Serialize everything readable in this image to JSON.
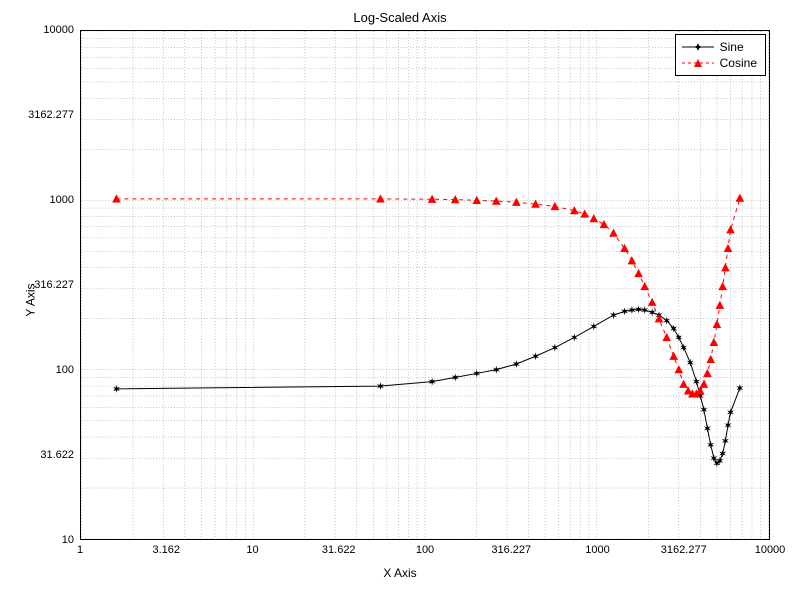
{
  "chart_data": {
    "type": "line",
    "title": "Log-Scaled Axis",
    "xlabel": "X Axis",
    "ylabel": "Y Axis",
    "xscale": "log",
    "yscale": "log",
    "xlim": [
      1,
      10000
    ],
    "ylim": [
      10,
      10000
    ],
    "x_ticks": [
      1,
      3.162,
      10,
      31.622,
      100,
      316.227,
      1000,
      3162.277,
      10000
    ],
    "x_tick_labels": [
      "1",
      "3.162",
      "10",
      "31.622",
      "100",
      "316.227",
      "1000",
      "3162.277",
      "10000"
    ],
    "y_ticks": [
      10,
      31.622,
      100,
      316.227,
      1000,
      3162.277,
      10000
    ],
    "y_tick_labels": [
      "10",
      "31.622",
      "100",
      "316.227",
      "1000",
      "3162.277",
      "10000"
    ],
    "grid": true,
    "minor_grid": true,
    "legend_position": "upper right",
    "series": [
      {
        "name": "Sine",
        "color": "#000000",
        "marker": "star6",
        "linestyle": "solid",
        "x": [
          1.6,
          55,
          110,
          150,
          200,
          260,
          340,
          440,
          570,
          740,
          960,
          1250,
          1450,
          1600,
          1750,
          1900,
          2100,
          2300,
          2550,
          2800,
          3000,
          3200,
          3500,
          3800,
          4000,
          4200,
          4400,
          4600,
          4800,
          5000,
          5200,
          5400,
          5600,
          5800,
          6000,
          6800
        ],
        "y": [
          77,
          80,
          85,
          90,
          95,
          100,
          108,
          120,
          135,
          155,
          180,
          210,
          221,
          225,
          227,
          225,
          218,
          210,
          195,
          175,
          155,
          135,
          110,
          85,
          70,
          58,
          45,
          36,
          30,
          28,
          29,
          32,
          38,
          47,
          56,
          78
        ]
      },
      {
        "name": "Cosine",
        "color": "#ff0000",
        "marker": "triangle",
        "linestyle": "dashed",
        "x": [
          1.6,
          55,
          110,
          150,
          200,
          260,
          340,
          440,
          570,
          740,
          850,
          960,
          1100,
          1250,
          1450,
          1600,
          1750,
          1900,
          2100,
          2300,
          2550,
          2800,
          3000,
          3200,
          3400,
          3600,
          3800,
          4000,
          4200,
          4400,
          4600,
          4800,
          5000,
          5200,
          5400,
          5600,
          5800,
          6000,
          6800
        ],
        "y": [
          1020,
          1020,
          1015,
          1010,
          1000,
          990,
          975,
          950,
          920,
          870,
          830,
          780,
          720,
          640,
          520,
          440,
          370,
          310,
          250,
          200,
          155,
          120,
          100,
          82,
          75,
          72,
          72,
          75,
          82,
          95,
          115,
          145,
          185,
          240,
          310,
          400,
          520,
          670,
          1030
        ]
      }
    ]
  }
}
